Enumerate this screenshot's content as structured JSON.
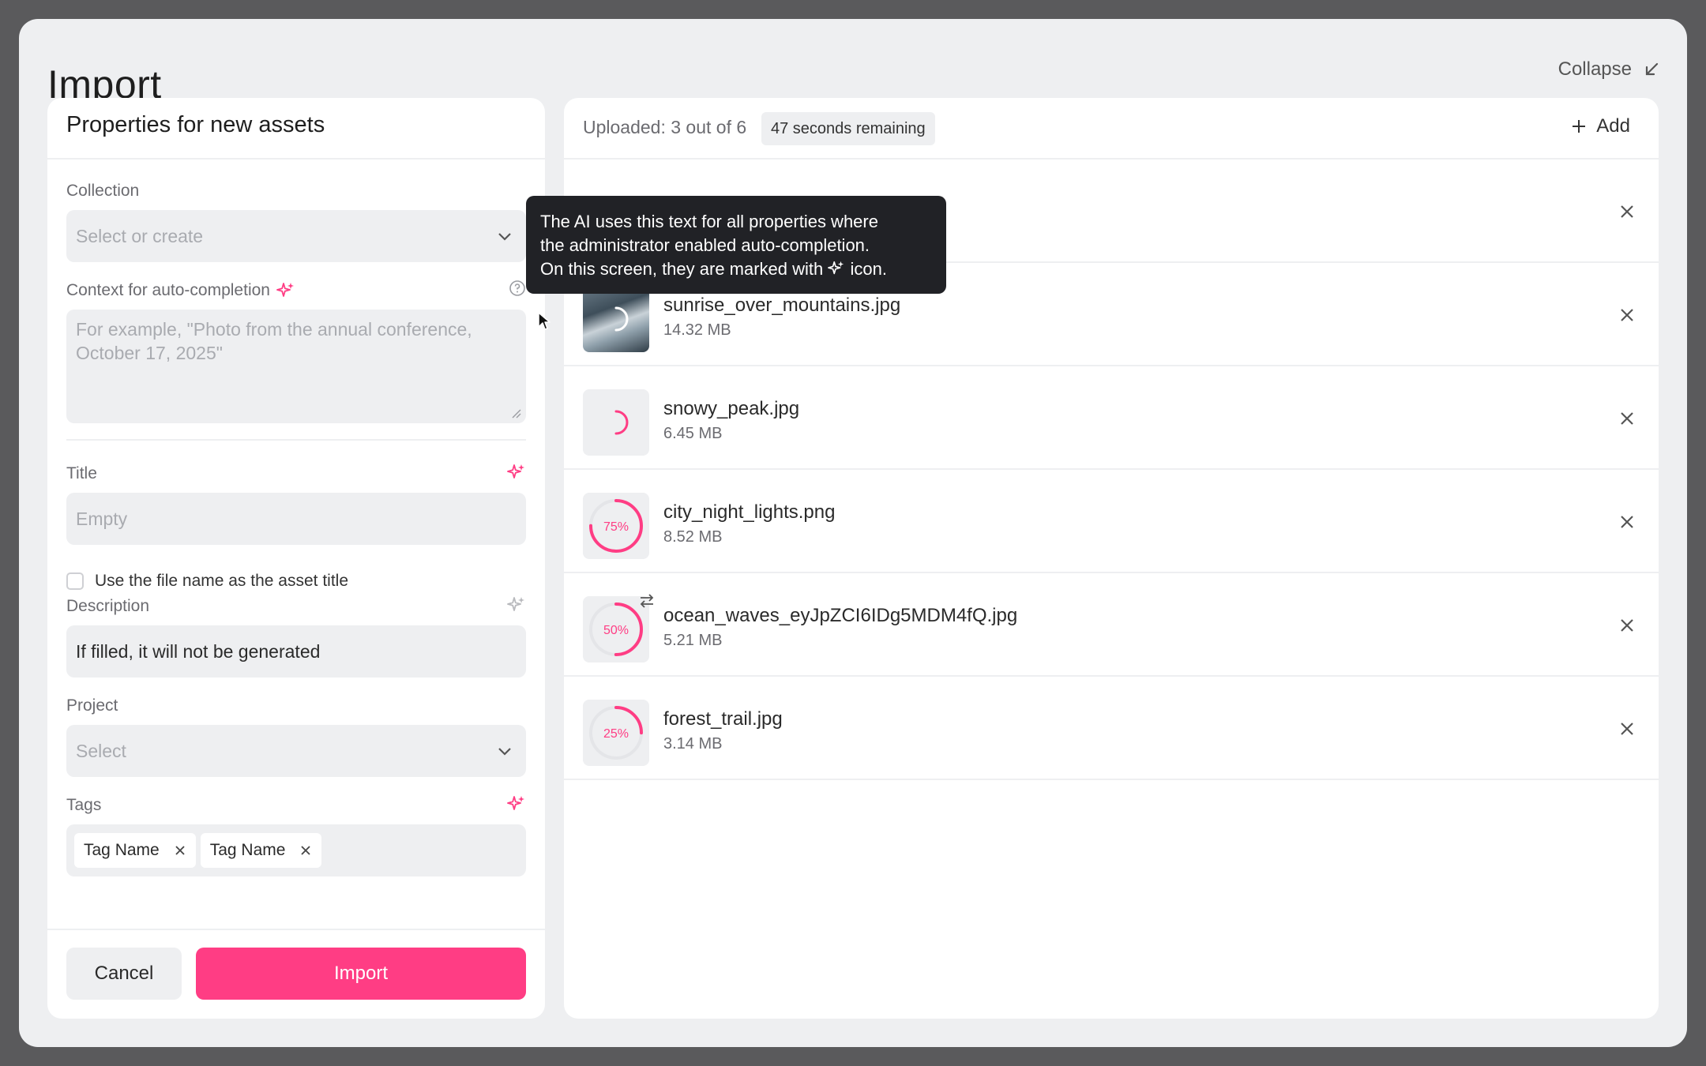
{
  "modal": {
    "title": "Import",
    "collapse_label": "Collapse"
  },
  "properties": {
    "header": "Properties for new assets",
    "collection": {
      "label": "Collection",
      "placeholder": "Select or create"
    },
    "context": {
      "label": "Context for auto-completion",
      "placeholder": "For example, \"Photo from the annual conference, October 17, 2025\""
    },
    "title": {
      "label": "Title",
      "placeholder": "Empty"
    },
    "use_filename_label": "Use the file name as the asset title",
    "description": {
      "label": "Description",
      "value": "If filled, it will not be generated"
    },
    "project": {
      "label": "Project",
      "placeholder": "Select"
    },
    "tags": {
      "label": "Tags",
      "items": [
        "Tag Name",
        "Tag Name"
      ]
    },
    "cancel_label": "Cancel",
    "import_label": "Import"
  },
  "uploads": {
    "status": "Uploaded: 3 out of 6",
    "remaining": "47 seconds remaining",
    "add_label": "Add",
    "files": [
      {
        "name": "sunrise_over_mountains.jpg",
        "size": "14.32 MB",
        "state": "loading"
      },
      {
        "name": "snowy_peak.jpg",
        "size": "6.45 MB",
        "state": "loading"
      },
      {
        "name": "city_night_lights.png",
        "size": "8.52 MB",
        "progress": 75,
        "progress_label": "75%"
      },
      {
        "name": "ocean_waves_eyJpZCI6IDg5MDM4fQ.jpg",
        "size": "5.21 MB",
        "progress": 50,
        "progress_label": "50%"
      },
      {
        "name": "forest_trail.jpg",
        "size": "3.14 MB",
        "progress": 25,
        "progress_label": "25%"
      }
    ]
  },
  "tooltip": {
    "line1": "The AI uses this text for all properties where",
    "line2": "the administrator enabled auto-completion.",
    "line3_before": "On this screen, they are marked with",
    "line3_after": "icon."
  },
  "colors": {
    "accent": "#ff3d84",
    "panel_bg": "#eeeff1",
    "tooltip_bg": "#212226"
  }
}
